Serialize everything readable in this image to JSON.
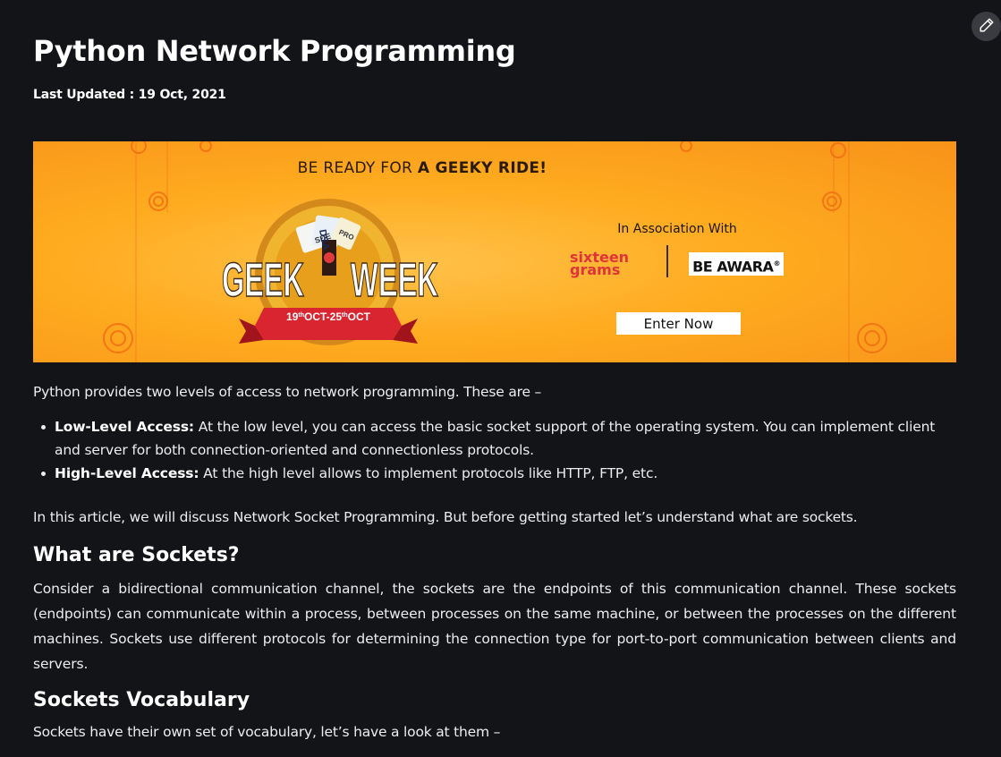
{
  "article": {
    "title": "Python Network Programming",
    "last_updated": "Last Updated : 19 Oct, 2021",
    "intro": "Python provides two levels of access to network programming. These are –",
    "bullets": [
      {
        "term": "Low-Level Access:",
        "text": " At the low level, you can access the basic socket support of the operating system. You can implement client and server for both connection-oriented and connectionless protocols."
      },
      {
        "term": "High-Level Access:",
        "text": " At the high level allows to implement protocols like HTTP, FTP, etc."
      }
    ],
    "para1": "In this article, we will discuss Network Socket Programming. But before getting started let’s understand what are sockets.",
    "heading1": "What are Sockets?",
    "para2": "Consider a bidirectional communication channel, the sockets are the endpoints of this communication channel. These sockets (endpoints) can communicate within a process, between processes on the same machine, or between the processes on the different machines. Sockets use different protocols for determining the connection type for port-to-port communication between clients and servers.",
    "heading2": "Sockets Vocabulary",
    "para3": "Sockets have their own set of vocabulary, let’s have a look at them –"
  },
  "banner": {
    "headline_pre": "BE READY FOR ",
    "headline_bold": "A GEEKY RIDE!",
    "logo_left": "GEEK",
    "logo_right": "WEEK",
    "dates": "19",
    "dates_sup1": "th",
    "dates_mid": "OCT-25",
    "dates_sup2": "th",
    "dates_end": "OCT",
    "ticket1": "DSA",
    "ticket2": "SDE",
    "ticket3": "PRO",
    "association": "In Association With",
    "sponsor1_line1": "sixteen",
    "sponsor1_line2": "grams",
    "sponsor2": "BE AWARA",
    "sponsor2_mark": "®",
    "cta": "Enter Now"
  },
  "icons": {
    "edit": "pencil-icon"
  },
  "colors": {
    "background": "#131417",
    "banner": "#ffab1f",
    "text": "#ecedef"
  }
}
